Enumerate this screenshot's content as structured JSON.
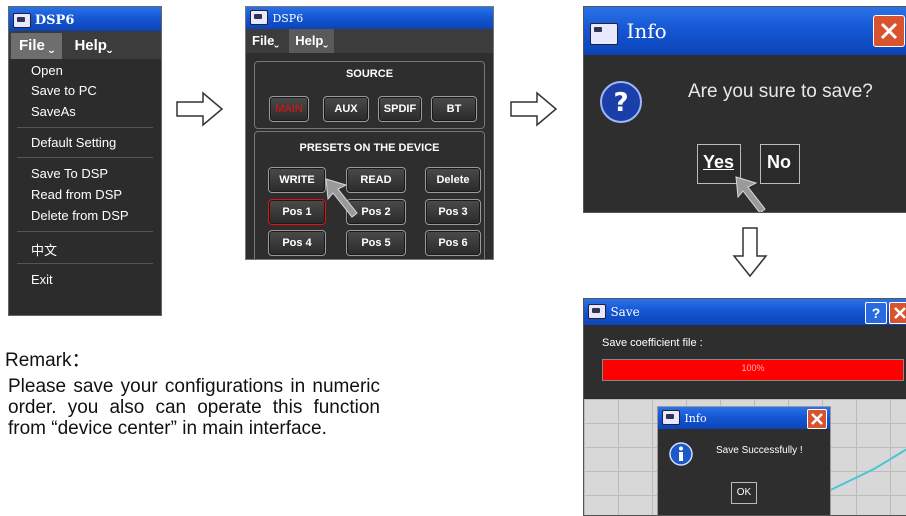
{
  "menu_window": {
    "title": "DSP6",
    "menubar": [
      "File",
      "Help"
    ],
    "items": [
      "Open",
      "Save to PC",
      "SaveAs",
      "Default Setting",
      "Save To DSP",
      "Read from DSP",
      "Delete from DSP",
      "中文",
      "Exit"
    ]
  },
  "dsp_panel": {
    "title": "DSP6",
    "menubar": [
      "File",
      "Help"
    ],
    "source_label": "SOURCE",
    "sources": [
      "MAIN",
      "AUX",
      "SPDIF",
      "BT"
    ],
    "presets_label": "PRESETS ON THE DEVICE",
    "actions": [
      "WRITE",
      "READ",
      "Delete"
    ],
    "positions": [
      "Pos 1",
      "Pos 2",
      "Pos 3",
      "Pos 4",
      "Pos 5",
      "Pos 6"
    ]
  },
  "confirm_dialog": {
    "title": "Info",
    "message": "Are you sure to save?",
    "yes": "Yes",
    "no": "No"
  },
  "save_window": {
    "title": "Save",
    "label": "Save coefficient file :",
    "progress_text": "100%",
    "progress": 1.0
  },
  "success_dialog": {
    "title": "Info",
    "message": "Save Successfully !",
    "ok": "OK"
  },
  "remark": {
    "title": "Remark：",
    "text": "Please save your configurations in numeric order. you also can operate this function from “device center” in main interface."
  },
  "colors": {
    "accent_red": "#e81010",
    "progress_red": "#ff0000",
    "title_blue": "#1557d4",
    "dark_bg": "#2e2e2e"
  }
}
